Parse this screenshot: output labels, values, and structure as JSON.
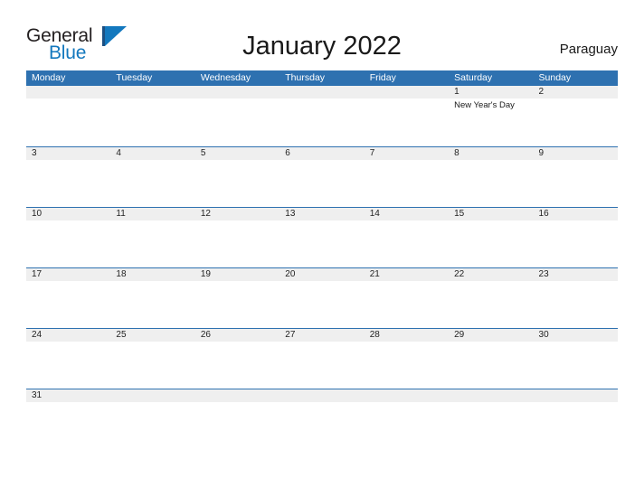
{
  "brand": {
    "name_part1": "General",
    "name_part2": "Blue",
    "sail_icon": "sail-triangle-icon",
    "color_dark": "#231f20",
    "color_blue": "#1378be"
  },
  "header": {
    "title": "January 2022",
    "locale": "Paraguay"
  },
  "theme": {
    "accent": "#2e71b0",
    "band": "#efefef",
    "page_bg": "#ffffff",
    "text": "#1a1a1a"
  },
  "calendar": {
    "month": "January",
    "year": "2022",
    "day_names": [
      "Monday",
      "Tuesday",
      "Wednesday",
      "Thursday",
      "Friday",
      "Saturday",
      "Sunday"
    ],
    "weeks": [
      {
        "ruled": false,
        "days": [
          {
            "num": "",
            "events": []
          },
          {
            "num": "",
            "events": []
          },
          {
            "num": "",
            "events": []
          },
          {
            "num": "",
            "events": []
          },
          {
            "num": "",
            "events": []
          },
          {
            "num": "1",
            "events": [
              "New Year's Day"
            ]
          },
          {
            "num": "2",
            "events": []
          }
        ]
      },
      {
        "ruled": true,
        "days": [
          {
            "num": "3",
            "events": []
          },
          {
            "num": "4",
            "events": []
          },
          {
            "num": "5",
            "events": []
          },
          {
            "num": "6",
            "events": []
          },
          {
            "num": "7",
            "events": []
          },
          {
            "num": "8",
            "events": []
          },
          {
            "num": "9",
            "events": []
          }
        ]
      },
      {
        "ruled": true,
        "days": [
          {
            "num": "10",
            "events": []
          },
          {
            "num": "11",
            "events": []
          },
          {
            "num": "12",
            "events": []
          },
          {
            "num": "13",
            "events": []
          },
          {
            "num": "14",
            "events": []
          },
          {
            "num": "15",
            "events": []
          },
          {
            "num": "16",
            "events": []
          }
        ]
      },
      {
        "ruled": true,
        "days": [
          {
            "num": "17",
            "events": []
          },
          {
            "num": "18",
            "events": []
          },
          {
            "num": "19",
            "events": []
          },
          {
            "num": "20",
            "events": []
          },
          {
            "num": "21",
            "events": []
          },
          {
            "num": "22",
            "events": []
          },
          {
            "num": "23",
            "events": []
          }
        ]
      },
      {
        "ruled": true,
        "days": [
          {
            "num": "24",
            "events": []
          },
          {
            "num": "25",
            "events": []
          },
          {
            "num": "26",
            "events": []
          },
          {
            "num": "27",
            "events": []
          },
          {
            "num": "28",
            "events": []
          },
          {
            "num": "29",
            "events": []
          },
          {
            "num": "30",
            "events": []
          }
        ]
      },
      {
        "ruled": true,
        "days": [
          {
            "num": "31",
            "events": []
          },
          {
            "num": "",
            "events": []
          },
          {
            "num": "",
            "events": []
          },
          {
            "num": "",
            "events": []
          },
          {
            "num": "",
            "events": []
          },
          {
            "num": "",
            "events": []
          },
          {
            "num": "",
            "events": []
          }
        ]
      }
    ]
  }
}
